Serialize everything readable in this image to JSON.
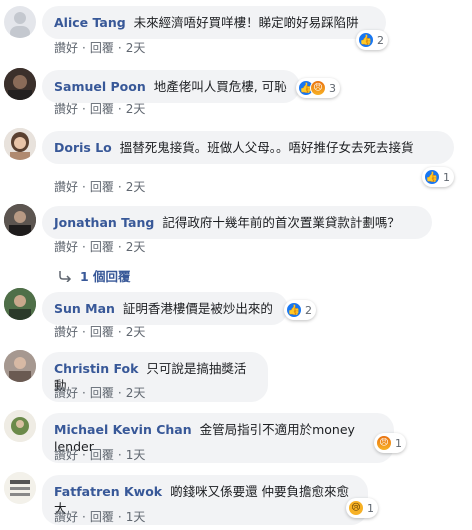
{
  "actions": {
    "like": "讚好",
    "reply": "回覆",
    "sep": "·"
  },
  "comments": [
    {
      "author": "Alice Tang",
      "text": "未來經濟唔好買咩樓！睇定啲好易踩陷阱",
      "time": "2天",
      "reactions": {
        "types": [
          "like"
        ],
        "count": "2"
      }
    },
    {
      "author": "Samuel Poon",
      "text": "地產佬叫人買危樓, 可恥",
      "time": "2天",
      "reactions": {
        "types": [
          "like",
          "angry"
        ],
        "count": "3"
      }
    },
    {
      "author": "Doris Lo",
      "text": "搵替死鬼接貨。班做人父母。。唔好推仔女去死去接貨",
      "time": "2天",
      "reactions": {
        "types": [
          "like"
        ],
        "count": "1"
      }
    },
    {
      "author": "Jonathan Tang",
      "text": "記得政府十幾年前的首次置業貸款計劃嗎？",
      "time": "2天",
      "replies": "1 個回覆"
    },
    {
      "author": "Sun Man",
      "text": "証明香港樓價是被炒出來的",
      "time": "2天",
      "reactions": {
        "types": [
          "like"
        ],
        "count": "2"
      }
    },
    {
      "author": "Christin Fok",
      "text": "只可說是搞抽獎活動",
      "time": "2天"
    },
    {
      "author": "Michael Kevin Chan",
      "text": "金管局指引不適用於money lender",
      "time": "1天",
      "reactions": {
        "types": [
          "angry"
        ],
        "count": "1"
      }
    },
    {
      "author": "Fatfatren Kwok",
      "text": "啲錢咪又係要還 仲要負擔愈來愈大",
      "time": "1天",
      "reactions": {
        "types": [
          "sad"
        ],
        "count": "1"
      }
    }
  ]
}
